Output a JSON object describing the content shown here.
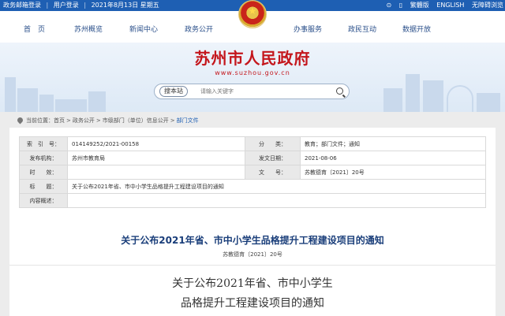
{
  "topbar": {
    "left": [
      "政务邮箱登录",
      "|",
      "用户登录",
      "|",
      "2021年8月13日 星期五"
    ],
    "right": [
      "⊙",
      "▯",
      "繁體版",
      "ENGLISH",
      "无障碍浏览"
    ]
  },
  "nav": [
    "首　页",
    "苏州概览",
    "新闻中心",
    "政务公开",
    "办事服务",
    "政民互动",
    "数据开放"
  ],
  "banner": {
    "title": "苏州市人民政府",
    "url": "www.suzhou.gov.cn",
    "search_button": "搜本站",
    "search_placeholder": "请输入关键字"
  },
  "breadcrumb": {
    "label": "当前位置：",
    "items": [
      "首页",
      "政务公开",
      "市级部门（单位）信息公开",
      "部门文件"
    ],
    "separator": ">"
  },
  "meta": {
    "rows": [
      [
        {
          "label": "索　引　号：",
          "value": "014149252/2021-00158"
        },
        {
          "label": "分　　类：",
          "value": "教育；部门文件；通知"
        }
      ],
      [
        {
          "label": "发布机构：",
          "value": "苏州市教育局"
        },
        {
          "label": "发文日期：",
          "value": "2021-08-06"
        }
      ],
      [
        {
          "label": "时　　效：",
          "value": ""
        },
        {
          "label": "文　　号：",
          "value": "苏教德育〔2021〕20号"
        }
      ]
    ],
    "title_label": "标　　题：",
    "title_value": "关于公布2021年省、市中小学生品格提升工程建设项目的通知",
    "summary_label": "内容概述：",
    "summary_value": ""
  },
  "doc": {
    "title": "关于公布2021年省、市中小学生品格提升工程建设项目的通知",
    "number": "苏教德育〔2021〕20号",
    "heading_line1": "关于公布2021年省、市中小学生",
    "heading_line2": "品格提升工程建设项目的通知"
  },
  "colors": {
    "topbar": "#1e5fb3",
    "brand_red": "#c4161c",
    "nav_text": "#2a4f8a",
    "doc_title": "#1a3e7a"
  }
}
